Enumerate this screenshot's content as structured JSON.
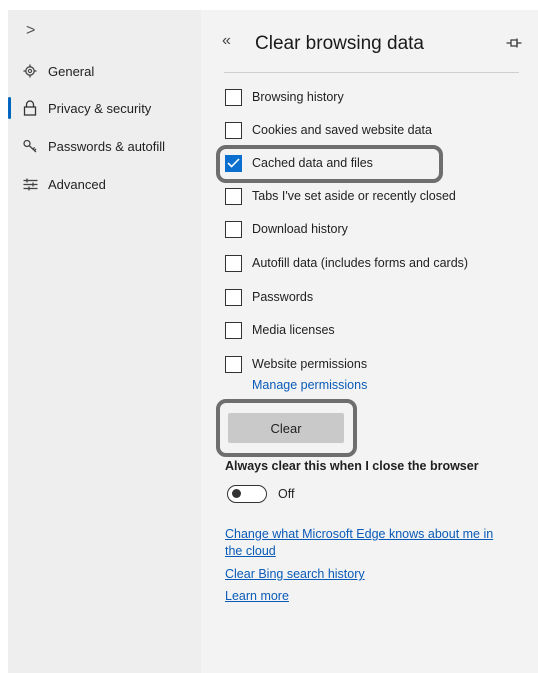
{
  "sidebar": {
    "expand_glyph": ">",
    "items": [
      {
        "label": "General",
        "icon": "gear-icon"
      },
      {
        "label": "Privacy & security",
        "icon": "lock-icon",
        "active": true
      },
      {
        "label": "Passwords & autofill",
        "icon": "key-icon"
      },
      {
        "label": "Advanced",
        "icon": "sliders-icon"
      }
    ]
  },
  "panel": {
    "collapse_glyph": "«",
    "title": "Clear browsing data",
    "pin_icon": "pin-icon",
    "options": [
      {
        "label": "Browsing history",
        "checked": false
      },
      {
        "label": "Cookies and saved website data",
        "checked": false
      },
      {
        "label": "Cached data and files",
        "checked": true
      },
      {
        "label": "Tabs I've set aside or recently closed",
        "checked": false
      },
      {
        "label": "Download history",
        "checked": false
      },
      {
        "label": "Autofill data (includes forms and cards)",
        "checked": false
      },
      {
        "label": "Passwords",
        "checked": false
      },
      {
        "label": "Media licenses",
        "checked": false
      },
      {
        "label": "Website permissions",
        "checked": false
      }
    ],
    "manage_permissions": "Manage permissions",
    "clear_button": "Clear",
    "always_clear_label": "Always clear this when I close the browser",
    "toggle_state": "Off",
    "links": [
      "Change what Microsoft Edge knows about me in",
      "the cloud",
      "Clear Bing search history",
      "Learn more"
    ]
  },
  "colors": {
    "accent": "#0b6fd0",
    "link": "#0a5bb8",
    "highlight_border": "#6e6e6e"
  }
}
